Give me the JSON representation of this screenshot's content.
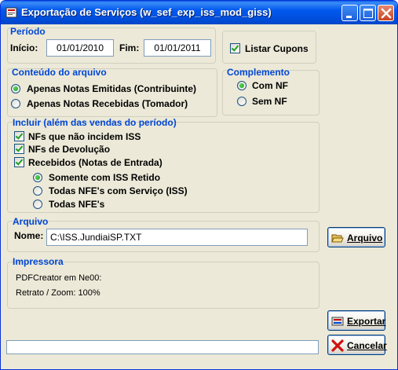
{
  "window": {
    "title": "Exportação de Serviços (w_sef_exp_iss_mod_giss)"
  },
  "periodo": {
    "label": "Período",
    "inicio_label": "Início:",
    "inicio_value": "01/01/2010",
    "fim_label": "Fim:",
    "fim_value": "01/01/2011",
    "listar_cupons": {
      "label": "Listar Cupons",
      "checked": true
    }
  },
  "conteudo": {
    "label": "Conteúdo do arquivo",
    "options": [
      {
        "label": "Apenas Notas Emitidas (Contribuinte)",
        "selected": true
      },
      {
        "label": "Apenas Notas Recebidas (Tomador)",
        "selected": false
      }
    ]
  },
  "complemento": {
    "label": "Complemento",
    "options": [
      {
        "label": "Com NF",
        "selected": true
      },
      {
        "label": "Sem NF",
        "selected": false
      }
    ]
  },
  "incluir": {
    "label": "Incluir (além das vendas do período)",
    "checks": [
      {
        "label": "NFs que não incidem ISS",
        "checked": true
      },
      {
        "label": "NFs de Devolução",
        "checked": true
      },
      {
        "label": "Recebidos (Notas de Entrada)",
        "checked": true
      }
    ],
    "sub_options": [
      {
        "label": "Somente com ISS Retido",
        "selected": true
      },
      {
        "label": "Todas NFE's com Serviço (ISS)",
        "selected": false
      },
      {
        "label": "Todas NFE's",
        "selected": false
      }
    ]
  },
  "arquivo": {
    "label": "Arquivo",
    "nome_label": "Nome:",
    "nome_value": "C:\\ISS.JundiaiSP.TXT",
    "button_label": "Arquivo"
  },
  "impressora": {
    "label": "Impressora",
    "line1": "PDFCreator em Ne00:",
    "line2": "Retrato / Zoom: 100%"
  },
  "buttons": {
    "exportar": "Exportar",
    "cancelar": "Cancelar"
  },
  "colors": {
    "group_label": "#0046d5",
    "titlebar": "#0058ee",
    "background": "#ece9d8"
  }
}
